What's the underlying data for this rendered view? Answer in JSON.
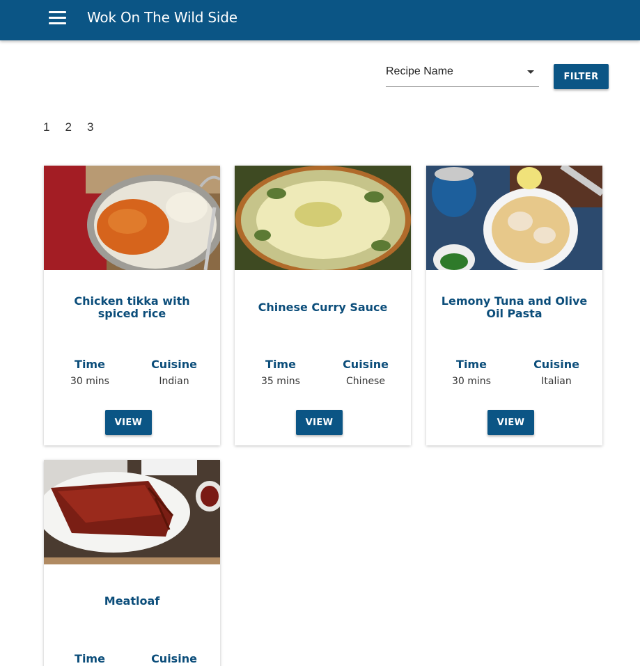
{
  "app": {
    "title": "Wok On The Wild Side"
  },
  "filter": {
    "select_value": "Recipe Name",
    "button_label": "FILTER"
  },
  "pagination": [
    "1",
    "2",
    "3"
  ],
  "labels": {
    "time": "Time",
    "cuisine": "Cuisine",
    "view": "VIEW"
  },
  "recipes": [
    {
      "title": "Chicken tikka with spiced rice",
      "time": "30 mins",
      "cuisine": "Indian"
    },
    {
      "title": "Chinese Curry Sauce",
      "time": "35 mins",
      "cuisine": "Chinese"
    },
    {
      "title": "Lemony Tuna and Olive Oil Pasta",
      "time": "30 mins",
      "cuisine": "Italian"
    },
    {
      "title": "Meatloaf",
      "time": "",
      "cuisine": ""
    }
  ],
  "colors": {
    "primary": "#0b5585",
    "heading": "#0b4d7a"
  }
}
